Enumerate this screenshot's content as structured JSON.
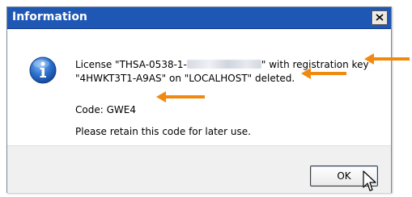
{
  "window": {
    "title": "Information",
    "close_label": "×"
  },
  "message": {
    "line1_prefix": "License \"THSA-0538-1-",
    "line1_suffix": "\" with registration key",
    "line2": "\"4HWKT3T1-A9AS\" on \"LOCALHOST\" deleted.",
    "code_line": "Code: GWE4",
    "retain_line": "Please retain this code for later use."
  },
  "buttons": {
    "ok_label": "OK"
  },
  "colors": {
    "titlebar": "#1f57b5",
    "annotation_arrow": "#f0890f",
    "info_icon": "#1f5fb8"
  },
  "icons": {
    "dialog_icon": "info-icon",
    "close": "close-icon",
    "pointer": "mouse-cursor-icon",
    "annotation": "arrow-left-icon"
  }
}
